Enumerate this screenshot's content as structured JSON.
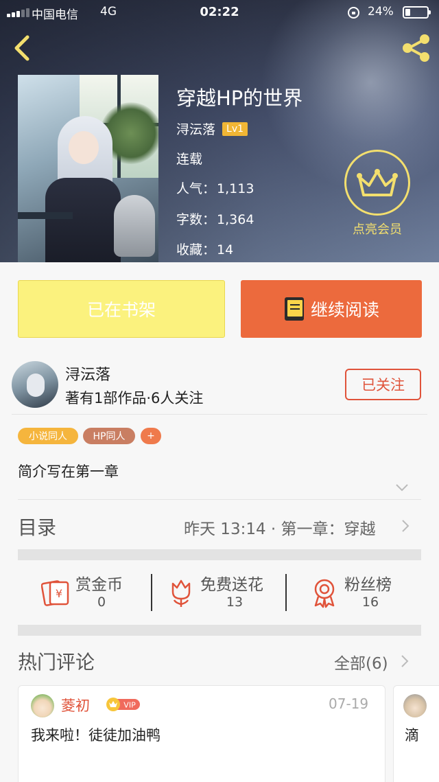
{
  "status_bar": {
    "carrier": "中国电信",
    "network": "4G",
    "time": "02:22",
    "battery": "24%"
  },
  "book": {
    "title": "穿越HP的世界",
    "author": "浔沄落",
    "level": "Lv1",
    "state": "连载",
    "stats": [
      {
        "label": "人气：",
        "value": "1,113"
      },
      {
        "label": "字数：",
        "value": "1,364"
      },
      {
        "label": "收藏：",
        "value": "14"
      }
    ]
  },
  "vip": {
    "label": "点亮会员"
  },
  "actions": {
    "shelf_label": "已在书架",
    "read_label": "继续阅读"
  },
  "writer": {
    "name": "浔沄落",
    "meta": "著有1部作品·6人关注",
    "follow_label": "已关注"
  },
  "tags": [
    {
      "label": "小说同人",
      "color": "#f5b53d"
    },
    {
      "label": "HP同人",
      "color": "#c97e62"
    },
    {
      "label": "+",
      "color": "#ef7a4c"
    }
  ],
  "intro": "简介写在第一章",
  "toc": {
    "title": "目录",
    "latest": "昨天 13:14 · 第一章：穿越"
  },
  "tools": [
    {
      "label": "赏金币",
      "count": "0",
      "icon": "red-envelope-icon"
    },
    {
      "label": "免费送花",
      "count": "13",
      "icon": "flower-icon"
    },
    {
      "label": "粉丝榜",
      "count": "16",
      "icon": "ribbon-icon"
    }
  ],
  "comments": {
    "title": "热门评论",
    "all_label": "全部(6)",
    "items": [
      {
        "user": "菱初",
        "badge": "VIP",
        "date": "07-19",
        "text": "我来啦！徒徒加油鸭"
      },
      {
        "text": "滴"
      }
    ]
  },
  "colors": {
    "accent": "#ec6a3d",
    "shelf": "#fbf27e",
    "follow": "#e0533a",
    "vip_gold": "#f3df6e",
    "level_badge": "#f1b635"
  }
}
